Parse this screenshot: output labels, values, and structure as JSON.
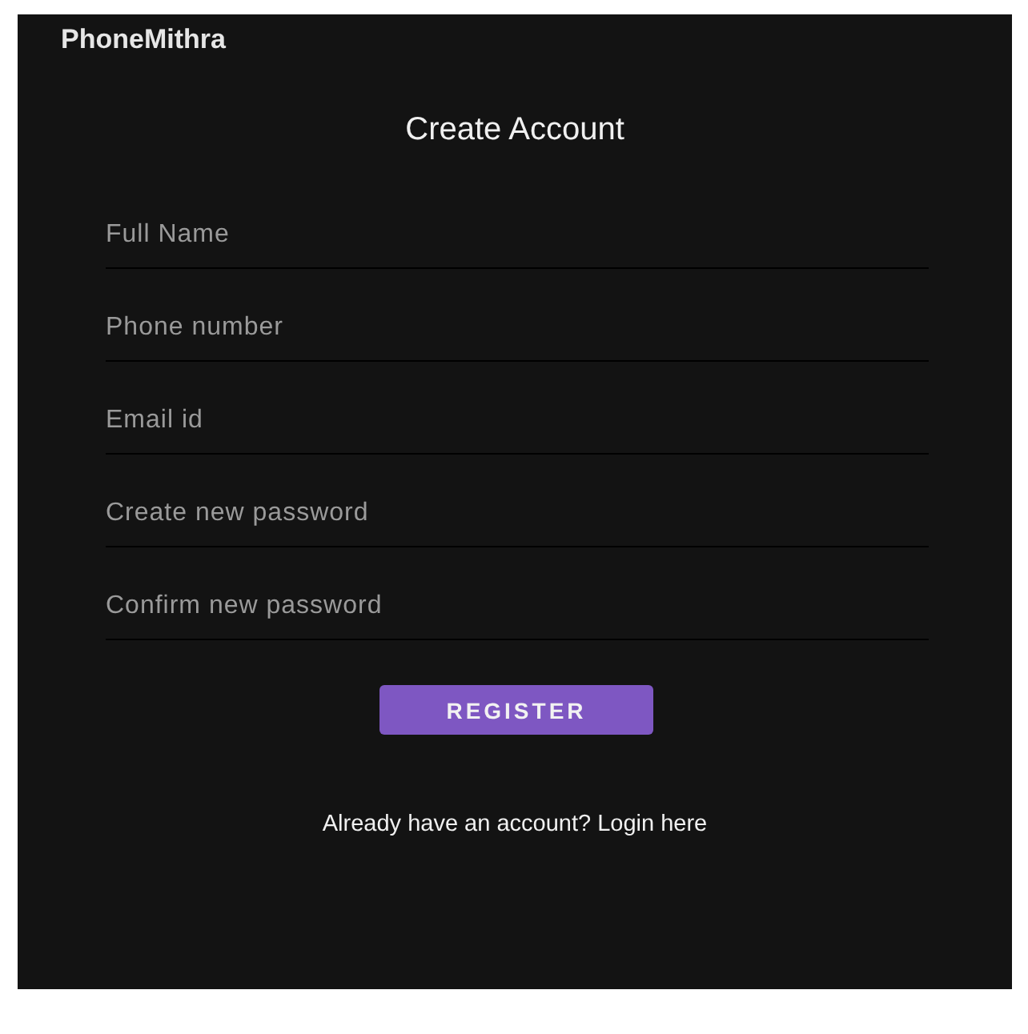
{
  "app_bar": {
    "title": "PhoneMithra"
  },
  "heading": "Create Account",
  "fields": [
    {
      "placeholder": "Full Name"
    },
    {
      "placeholder": "Phone number"
    },
    {
      "placeholder": "Email id"
    },
    {
      "placeholder": "Create new password"
    },
    {
      "placeholder": "Confirm new password"
    }
  ],
  "register_button": "REGISTER",
  "login_link": "Already have an account? Login here"
}
